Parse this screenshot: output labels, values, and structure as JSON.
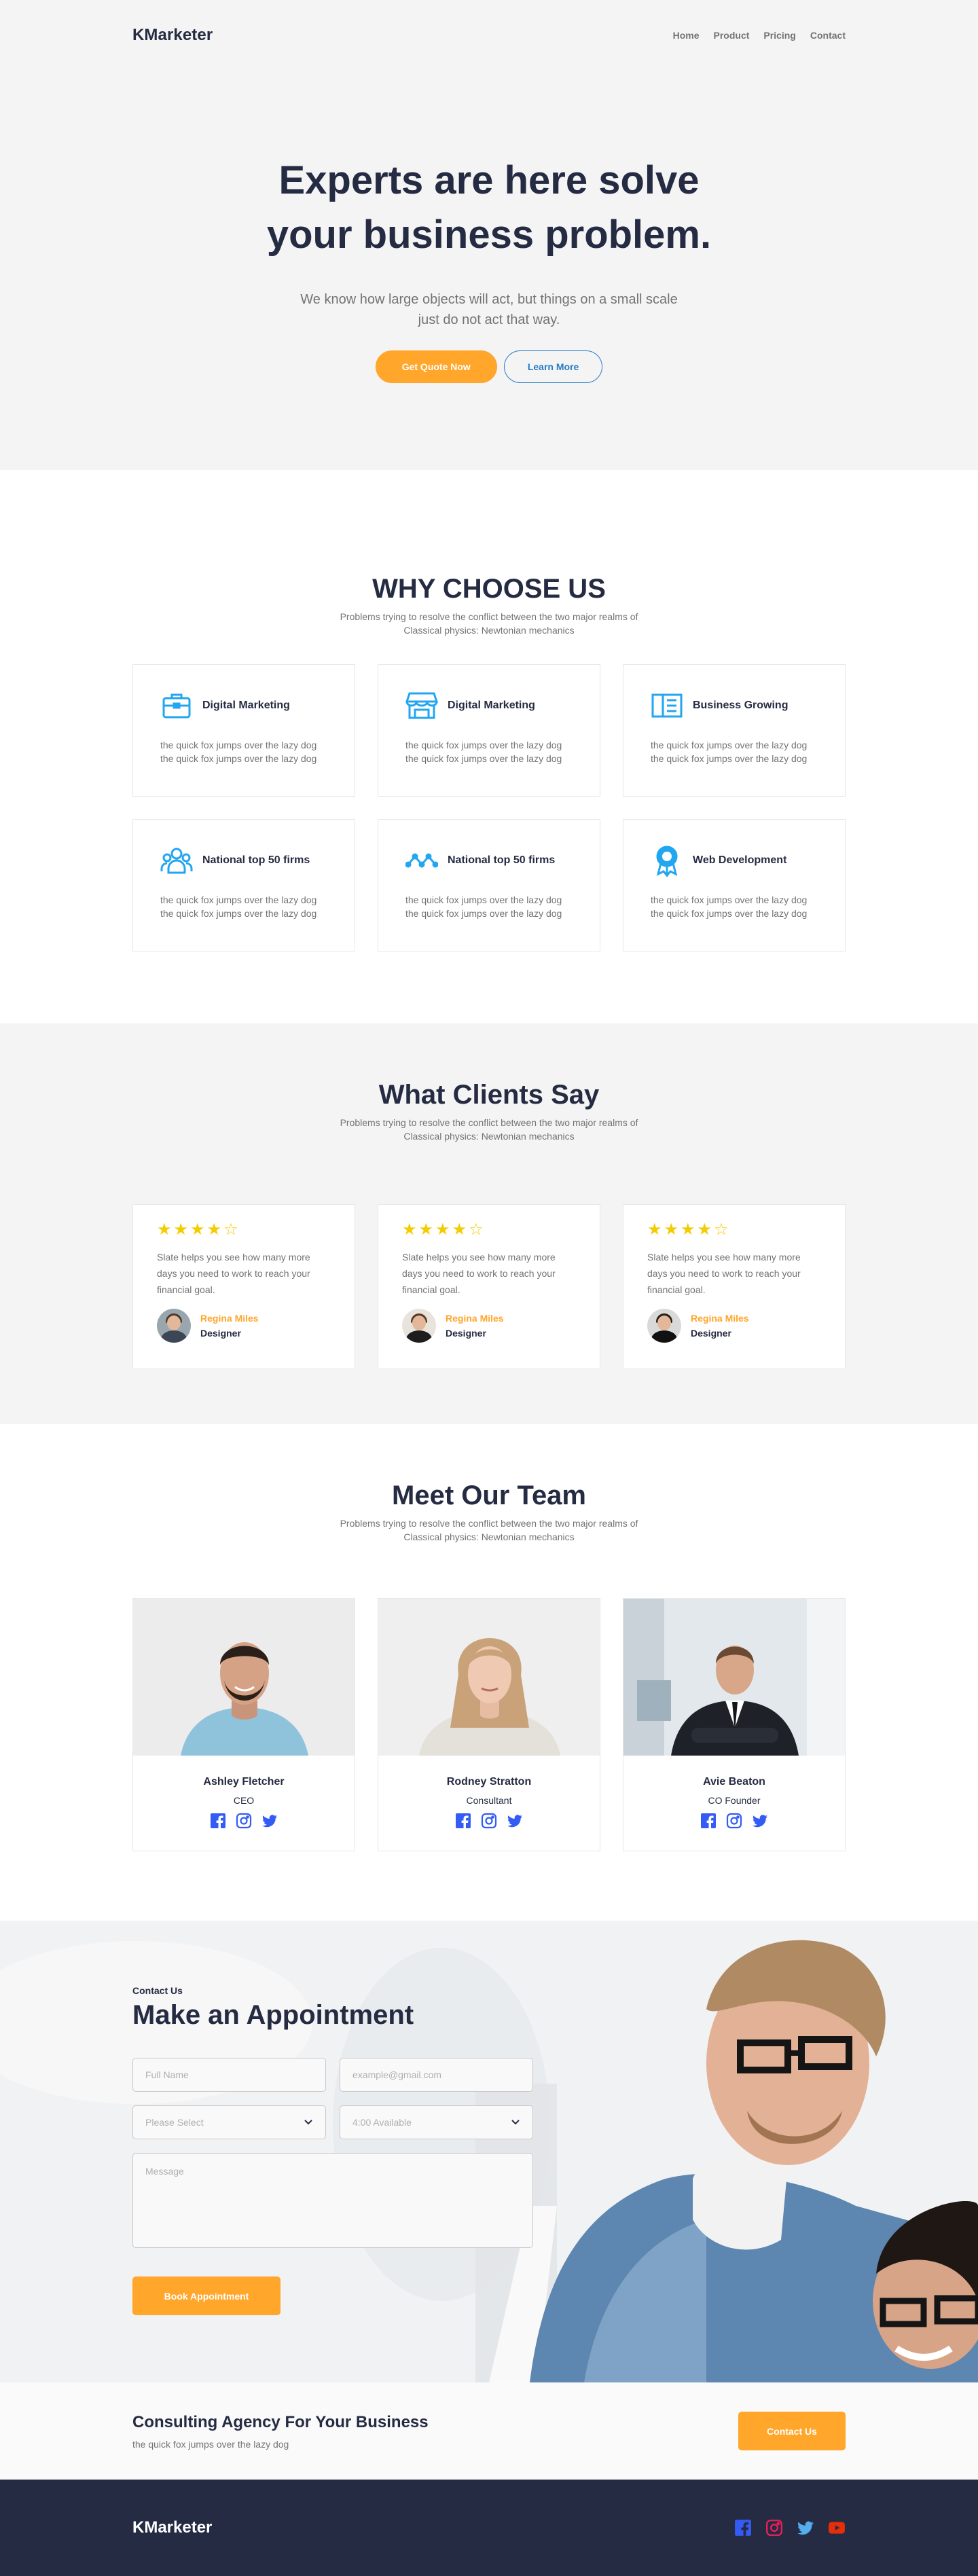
{
  "brand": "KMarketer",
  "nav": [
    "Home",
    "Product",
    "Pricing",
    "Contact"
  ],
  "hero": {
    "title_line1": "Experts are here solve",
    "title_line2": "your business problem.",
    "subtitle": "We know how large objects will act, but things on a small scale just do not act that way.",
    "primary_btn": "Get Quote Now",
    "secondary_btn": "Learn More"
  },
  "why": {
    "title": "WHY CHOOSE US",
    "subtitle": "Problems trying to resolve the conflict between the two major realms of Classical physics: Newtonian mechanics",
    "features": [
      {
        "icon": "briefcase-icon",
        "title": "Digital Marketing",
        "text": "the quick fox jumps over the lazy dog the quick fox jumps over the lazy dog"
      },
      {
        "icon": "storefront-icon",
        "title": "Digital Marketing",
        "text": "the quick fox jumps over the lazy dog the quick fox jumps over the lazy dog"
      },
      {
        "icon": "book-open-icon",
        "title": "Business Growing",
        "text": "the quick fox jumps over the lazy dog the quick fox jumps over the lazy dog"
      },
      {
        "icon": "users-icon",
        "title": "National top 50 firms",
        "text": "the quick fox jumps over the lazy dog the quick fox jumps over the lazy dog"
      },
      {
        "icon": "wave-icon",
        "title": "National top 50 firms",
        "text": "the quick fox jumps over the lazy dog the quick fox jumps over the lazy dog"
      },
      {
        "icon": "award-icon",
        "title": "Web Development",
        "text": "the quick fox jumps over the lazy dog the quick fox jumps over the lazy dog"
      }
    ]
  },
  "clients": {
    "title": "What Clients Say",
    "subtitle": "Problems trying to resolve the conflict between the two major realms of Classical physics: Newtonian mechanics",
    "testimonials": [
      {
        "rating": 4,
        "text": "Slate helps you see how many more days you need to work to reach your financial goal.",
        "name": "Regina Miles",
        "role": "Designer"
      },
      {
        "rating": 4,
        "text": "Slate helps you see how many more days you need to work to reach your financial goal.",
        "name": "Regina Miles",
        "role": "Designer"
      },
      {
        "rating": 4,
        "text": "Slate helps you see how many more days you need to work to reach your financial goal.",
        "name": "Regina Miles",
        "role": "Designer"
      }
    ]
  },
  "team": {
    "title": "Meet Our Team",
    "subtitle": "Problems trying to resolve the conflict between the two major realms of Classical physics: Newtonian mechanics",
    "members": [
      {
        "name": "Ashley Fletcher",
        "role": "CEO"
      },
      {
        "name": "Rodney Stratton",
        "role": "Consultant"
      },
      {
        "name": "Avie Beaton",
        "role": "CO Founder"
      }
    ]
  },
  "appointment": {
    "kicker": "Contact Us",
    "title": "Make an Appointment",
    "name_placeholder": "Full Name",
    "email_placeholder": "example@gmail.com",
    "select_value": "Please Select",
    "time_value": "4:00 Available",
    "message_placeholder": "Message",
    "button": "Book Appointment"
  },
  "cta": {
    "title": "Consulting Agency For Your Business",
    "subtitle": "the quick fox jumps over the lazy dog",
    "button": "Contact Us"
  },
  "footer": {
    "brand": "KMarketer"
  },
  "colors": {
    "accent_orange": "#FFA62B",
    "icon_teal": "#23A6F0",
    "dark": "#252B42",
    "star": "#F3CD03"
  }
}
